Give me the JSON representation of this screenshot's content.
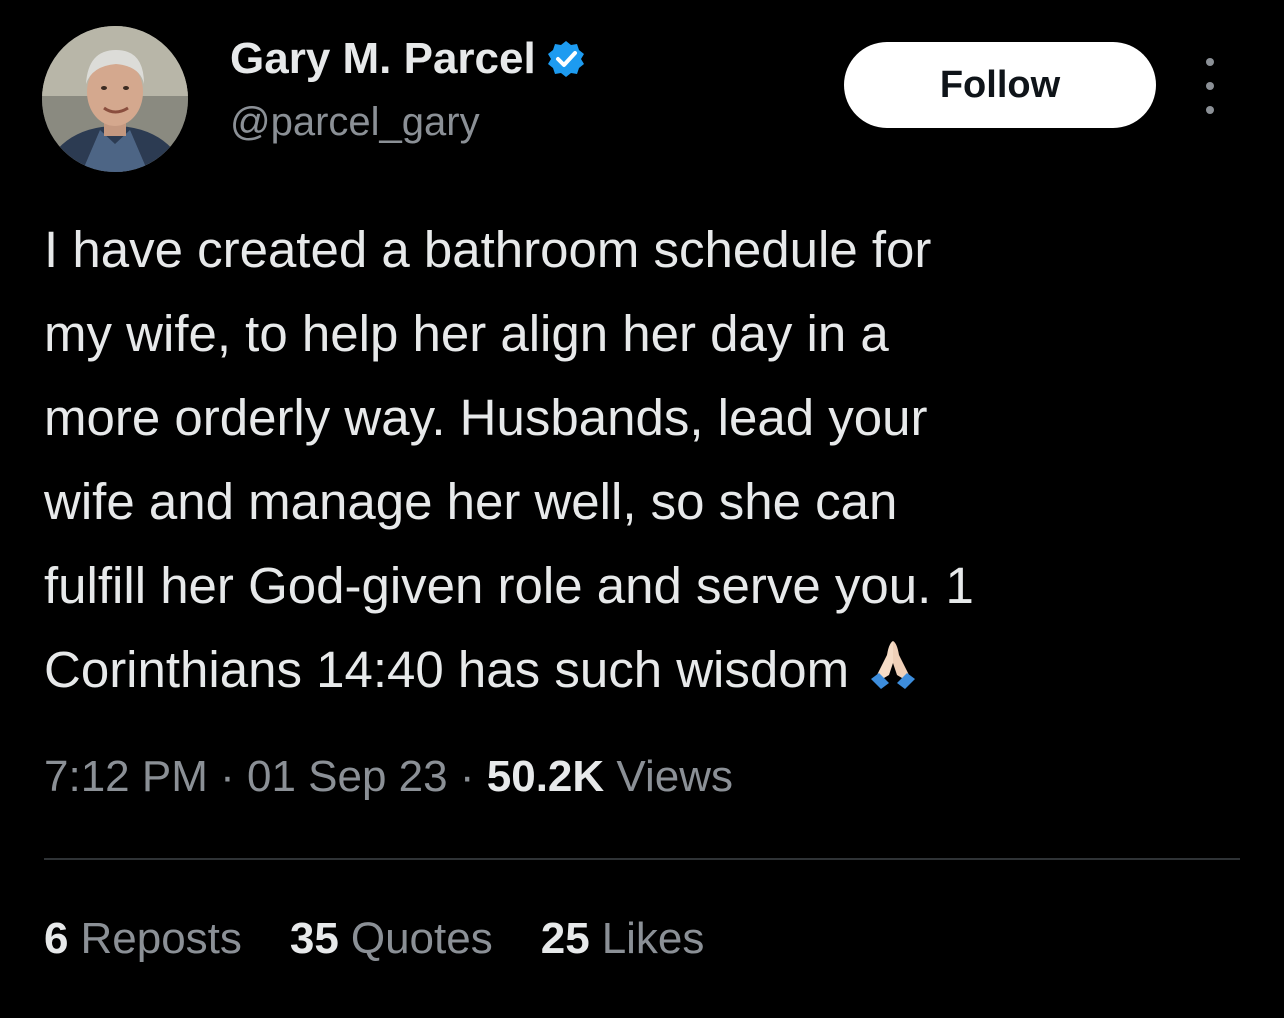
{
  "author": {
    "display_name": "Gary M. Parcel",
    "handle": "@parcel_gary",
    "verified": true,
    "verified_color": "#1d9bf0",
    "avatar_icon": "profile-photo"
  },
  "actions": {
    "follow_label": "Follow",
    "more_icon": "more-vertical-icon"
  },
  "tweet": {
    "lines": [
      "I have created a bathroom schedule for",
      "my wife, to help her align her day in a",
      "more orderly way. Husbands, lead your",
      "wife and manage her well, so she can",
      "fulfill her God-given role and serve you. 1",
      "Corinthians 14:40 has such wisdom"
    ],
    "emoji": "folded-hands-icon"
  },
  "meta": {
    "time": "7:12 PM",
    "date": "01 Sep 23",
    "separator": "·",
    "views_count": "50.2K",
    "views_label": "Views"
  },
  "stats": [
    {
      "count": "6",
      "label": "Reposts"
    },
    {
      "count": "35",
      "label": "Quotes"
    },
    {
      "count": "25",
      "label": "Likes"
    }
  ],
  "colors": {
    "background": "#000000",
    "text_primary": "#e7e9ea",
    "text_secondary": "#8b9096",
    "divider": "#2f3336",
    "follow_bg": "#ffffff"
  }
}
